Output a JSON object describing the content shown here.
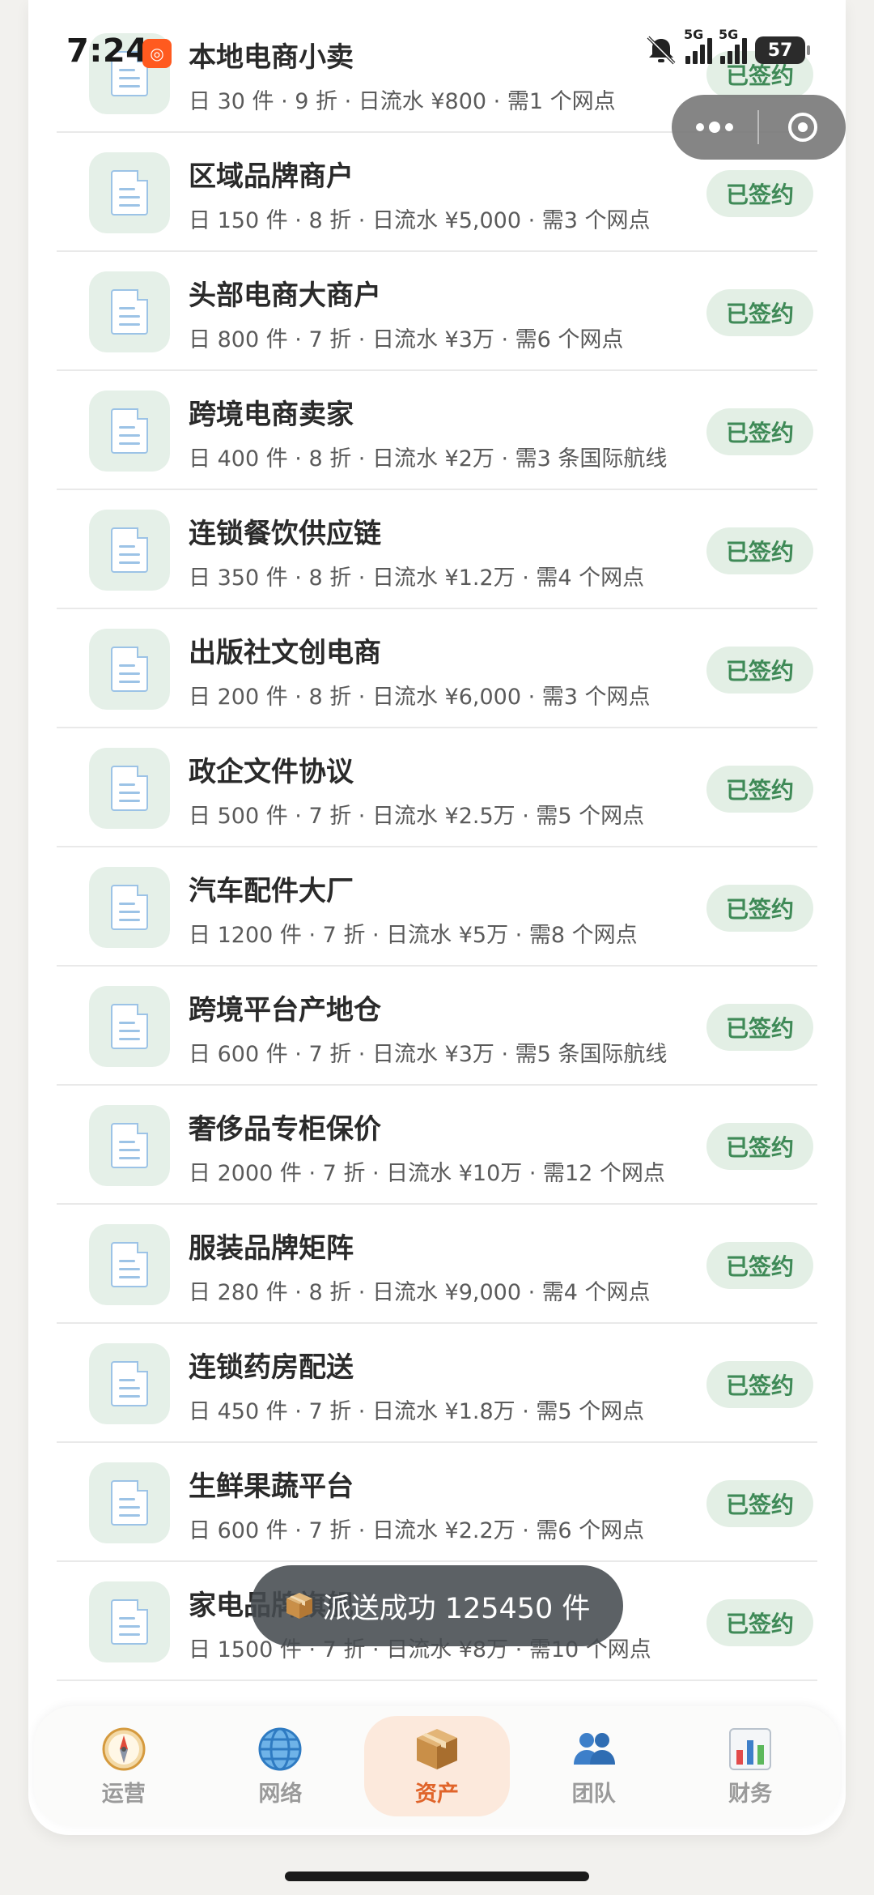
{
  "status_bar": {
    "time": "7:24",
    "net_1": "5G",
    "net_2": "5G",
    "battery": "57"
  },
  "capsule": {
    "menu_icon": "more-dots-icon",
    "close_icon": "target-icon"
  },
  "contracts": [
    {
      "title": "本地电商小卖",
      "meta": "日 30 件 · 9 折 · 日流水 ¥800 · 需1 个网点",
      "status": "已签约"
    },
    {
      "title": "区域品牌商户",
      "meta": "日 150 件 · 8 折 · 日流水 ¥5,000 · 需3 个网点",
      "status": "已签约"
    },
    {
      "title": "头部电商大商户",
      "meta": "日 800 件 · 7 折 · 日流水 ¥3万 · 需6 个网点",
      "status": "已签约"
    },
    {
      "title": "跨境电商卖家",
      "meta": "日 400 件 · 8 折 · 日流水 ¥2万 · 需3 条国际航线",
      "status": "已签约"
    },
    {
      "title": "连锁餐饮供应链",
      "meta": "日 350 件 · 8 折 · 日流水 ¥1.2万 · 需4 个网点",
      "status": "已签约"
    },
    {
      "title": "出版社文创电商",
      "meta": "日 200 件 · 8 折 · 日流水 ¥6,000 · 需3 个网点",
      "status": "已签约"
    },
    {
      "title": "政企文件协议",
      "meta": "日 500 件 · 7 折 · 日流水 ¥2.5万 · 需5 个网点",
      "status": "已签约"
    },
    {
      "title": "汽车配件大厂",
      "meta": "日 1200 件 · 7 折 · 日流水 ¥5万 · 需8 个网点",
      "status": "已签约"
    },
    {
      "title": "跨境平台产地仓",
      "meta": "日 600 件 · 7 折 · 日流水 ¥3万 · 需5 条国际航线",
      "status": "已签约"
    },
    {
      "title": "奢侈品专柜保价",
      "meta": "日 2000 件 · 7 折 · 日流水 ¥10万 · 需12 个网点",
      "status": "已签约"
    },
    {
      "title": "服装品牌矩阵",
      "meta": "日 280 件 · 8 折 · 日流水 ¥9,000 · 需4 个网点",
      "status": "已签约"
    },
    {
      "title": "连锁药房配送",
      "meta": "日 450 件 · 7 折 · 日流水 ¥1.8万 · 需5 个网点",
      "status": "已签约"
    },
    {
      "title": "生鲜果蔬平台",
      "meta": "日 600 件 · 7 折 · 日流水 ¥2.2万 · 需6 个网点",
      "status": "已签约"
    },
    {
      "title": "家电品牌旗舰",
      "meta": "日 1500 件 · 7 折 · 日流水 ¥8万 · 需10 个网点",
      "status": "已签约"
    }
  ],
  "toast": {
    "text": "派送成功 125450 件",
    "icon": "package-icon"
  },
  "tabbar": {
    "tabs": [
      {
        "label": "运营",
        "icon": "compass-icon"
      },
      {
        "label": "网络",
        "icon": "globe-icon"
      },
      {
        "label": "资产",
        "icon": "package-icon"
      },
      {
        "label": "团队",
        "icon": "people-icon"
      },
      {
        "label": "财务",
        "icon": "bar-chart-icon"
      }
    ],
    "active": "资产"
  },
  "colors": {
    "accent_orange": "#e0642a",
    "badge_green": "#3f8a57",
    "badge_bg": "#e3efe5",
    "icon_tile_bg": "#e5f0e8"
  }
}
